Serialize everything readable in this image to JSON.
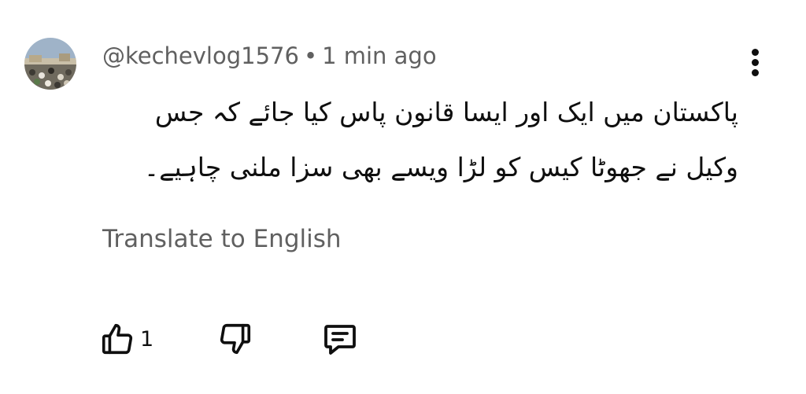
{
  "comment": {
    "author": "@kechevlog1576",
    "separator": "•",
    "time": "1 min ago",
    "text": "پاکستان میں ایک اور ایسا قانون پاس کیا جائے کہ جس وکیل نے جھوٹا کیس کو لڑا ویسے بھی سزا ملنی چاہیے۔",
    "translate_label": "Translate to English",
    "like_count": "1"
  },
  "icons": {
    "avatar": "avatar-photo",
    "menu": "more-vert-icon",
    "like": "thumb-up-icon",
    "dislike": "thumb-down-icon",
    "reply": "comment-icon"
  }
}
